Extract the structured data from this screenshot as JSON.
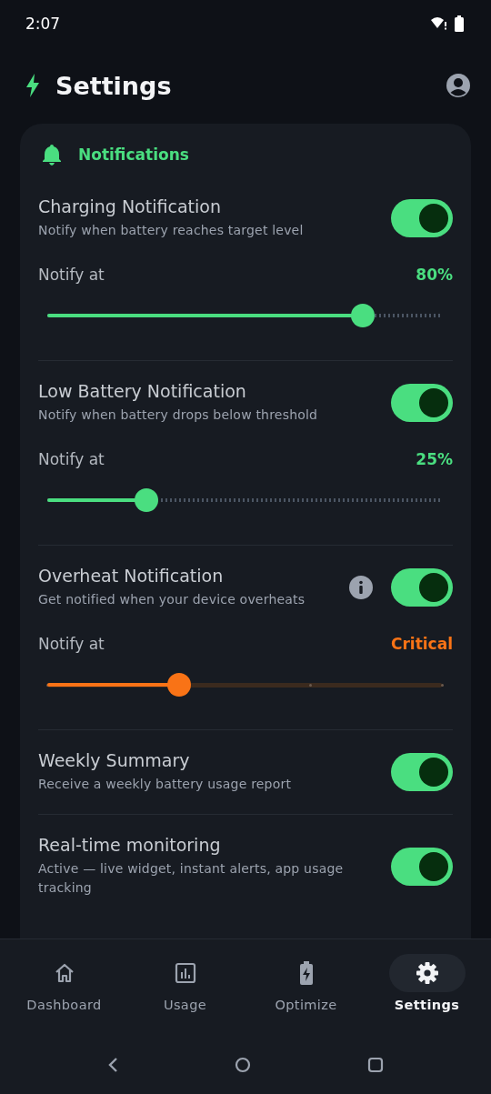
{
  "status_bar": {
    "time": "2:07"
  },
  "header": {
    "title": "Settings"
  },
  "section": {
    "title": "Notifications",
    "items": [
      {
        "kind": "slider",
        "title": "Charging Notification",
        "description": "Notify when battery reaches target level",
        "on": true,
        "slider": {
          "kind": "percent",
          "label": "Notify at",
          "value": "80%",
          "level": 0.8
        }
      },
      {
        "kind": "slider",
        "title": "Low Battery Notification",
        "description": "Notify when battery drops below threshold",
        "on": true,
        "slider": {
          "kind": "percent",
          "label": "Notify at",
          "value": "25%",
          "level": 0.25
        }
      },
      {
        "kind": "info_slider",
        "title": "Overheat Notification",
        "description": "Get notified when your device overheats",
        "on": true,
        "slider": {
          "kind": "severity",
          "label": "Notify at",
          "value": "Critical",
          "level": 0.333
        }
      },
      {
        "kind": "toggle",
        "title": "Weekly Summary",
        "description": "Receive a weekly battery usage report",
        "on": true
      },
      {
        "kind": "toggle",
        "title": "Real-time monitoring",
        "description": "Active — live widget, instant alerts, app usage tracking",
        "on": true
      }
    ]
  },
  "bottom_nav": [
    {
      "label": "Dashboard",
      "selected": false
    },
    {
      "label": "Usage",
      "selected": false
    },
    {
      "label": "Optimize",
      "selected": false
    },
    {
      "label": "Settings",
      "selected": true
    }
  ]
}
